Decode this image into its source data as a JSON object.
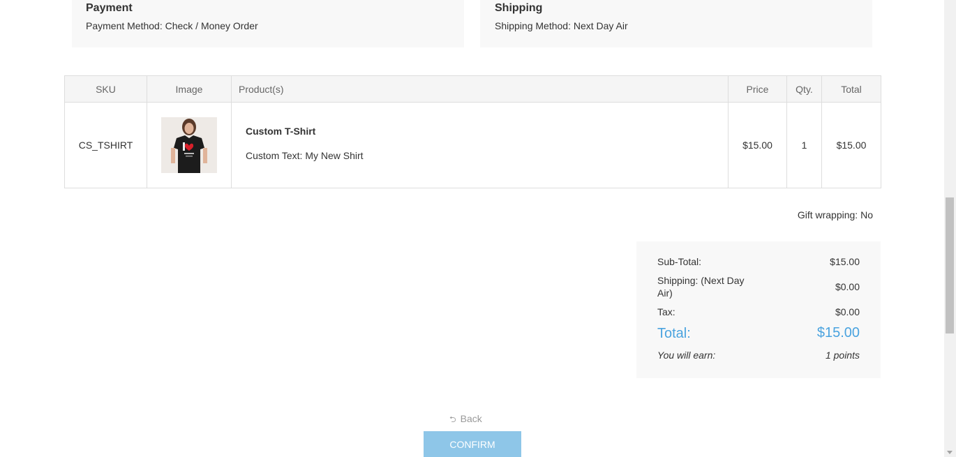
{
  "payment": {
    "title": "Payment",
    "method": "Payment Method: Check / Money Order"
  },
  "shipping": {
    "title": "Shipping",
    "method": "Shipping Method: Next Day Air"
  },
  "products_table": {
    "headers": {
      "sku": "SKU",
      "image": "Image",
      "product": "Product(s)",
      "price": "Price",
      "qty": "Qty.",
      "total": "Total"
    },
    "rows": [
      {
        "sku": "CS_TSHIRT",
        "image_icon": "tshirt-image",
        "name": "Custom T-Shirt",
        "option": "Custom Text: My New Shirt",
        "price": "$15.00",
        "qty": "1",
        "total": "$15.00"
      }
    ]
  },
  "gift_wrapping": "Gift wrapping: No",
  "totals": {
    "subtotal_label": "Sub-Total:",
    "subtotal_value": "$15.00",
    "shipping_label": "Shipping: (Next Day Air)",
    "shipping_value": "$0.00",
    "tax_label": "Tax:",
    "tax_value": "$0.00",
    "total_label": "Total:",
    "total_value": "$15.00",
    "earn_label": "You will earn:",
    "earn_value": "1 points"
  },
  "actions": {
    "back_label": "Back",
    "confirm_label": "CONFIRM"
  },
  "colors": {
    "accent": "#4aa3df",
    "confirm_bg": "#8ec6e8"
  }
}
